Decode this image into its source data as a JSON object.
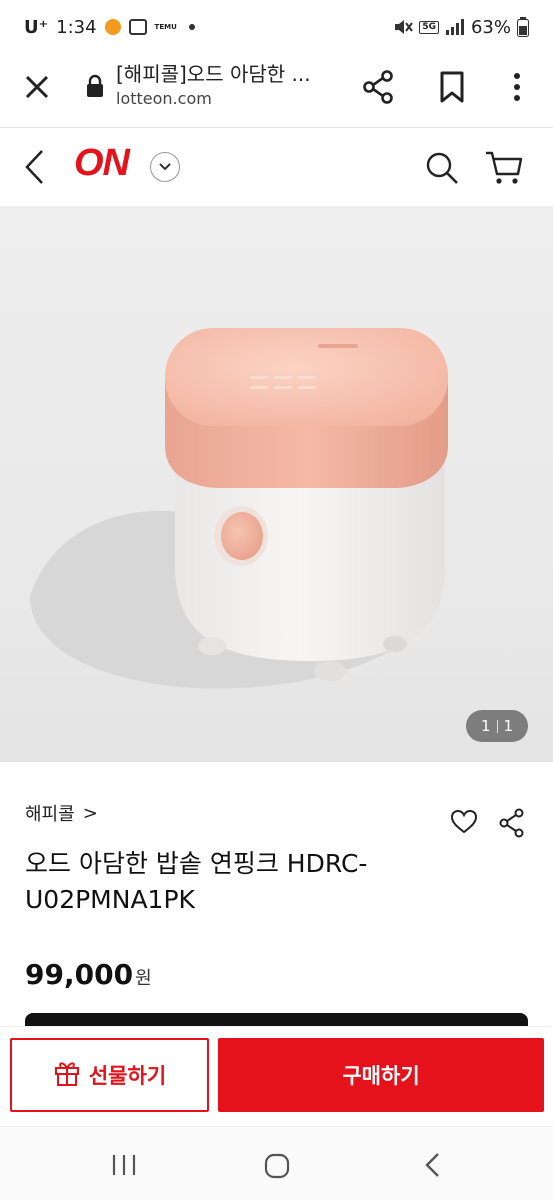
{
  "status_bar": {
    "carrier": "U⁺",
    "time": "1:34",
    "temu_badge": "TEMU",
    "network_badge": "5G",
    "battery": "63%"
  },
  "browser": {
    "page_title": "[해피콜]오드 아담한 ...",
    "domain": "lotteon.com"
  },
  "site": {
    "logo_text": "ON",
    "brand_color": "#e5121c"
  },
  "gallery": {
    "current": "1",
    "total": "1"
  },
  "product": {
    "brand": "해피콜",
    "brand_chevron": ">",
    "title_line1": "오드 아담한 밥솥 연핑크 HDRC-",
    "title_line2": "U02PMNA1PK",
    "price": "99,000",
    "currency": "원"
  },
  "actions": {
    "gift_label": "선물하기",
    "buy_label": "구매하기"
  },
  "icons": {
    "close": "close-icon",
    "lock": "lock-icon",
    "share": "share-icon",
    "bookmark": "bookmark-icon",
    "more": "more-vertical-icon",
    "back": "chevron-left-icon",
    "search": "search-icon",
    "cart": "cart-icon",
    "heart": "heart-icon",
    "gift": "gift-icon"
  }
}
